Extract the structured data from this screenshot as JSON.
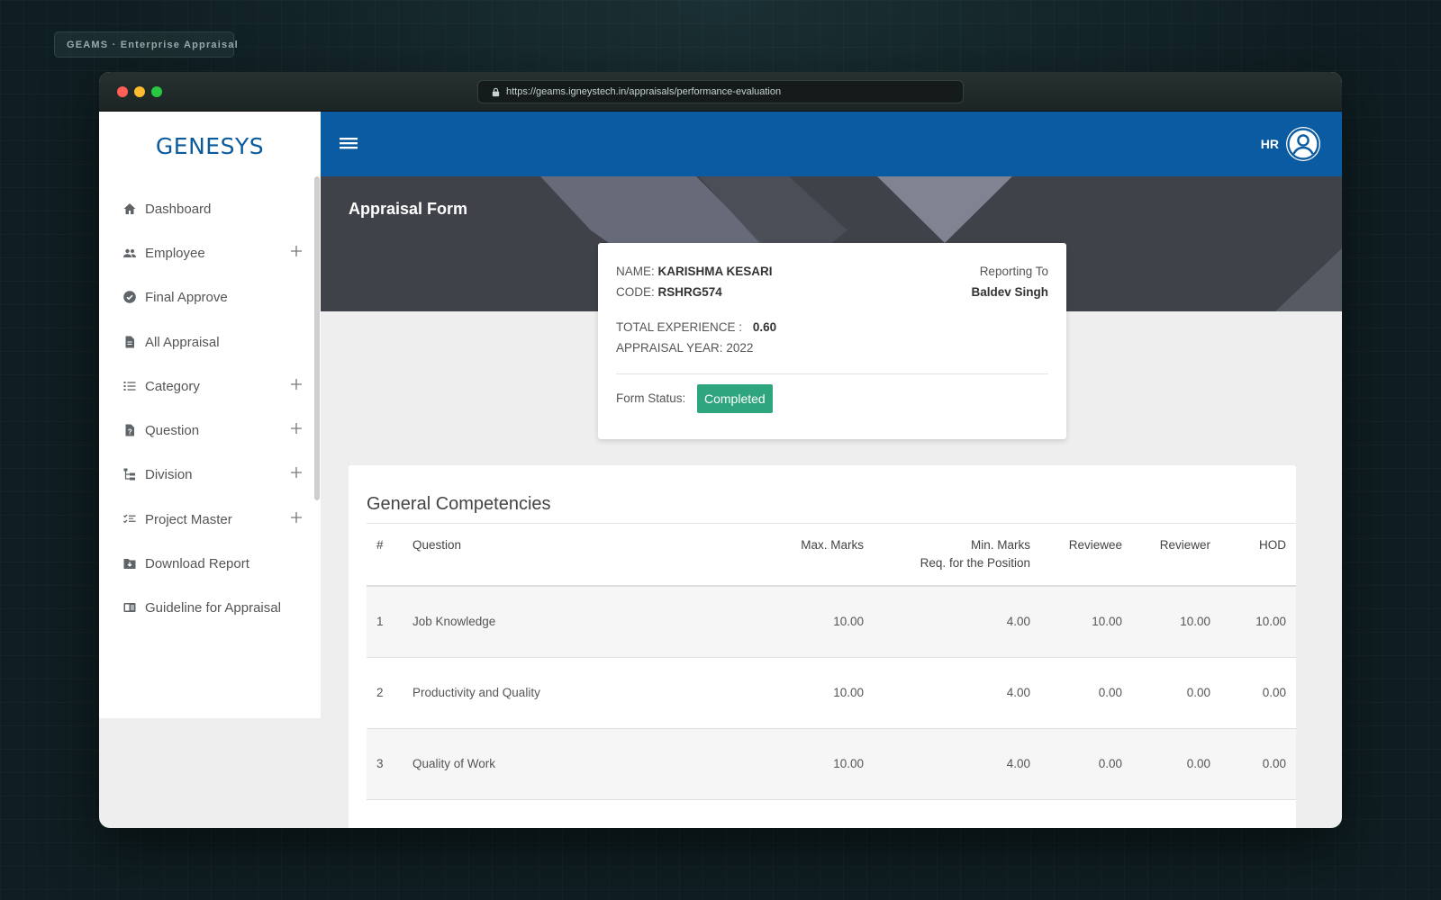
{
  "overlay": {
    "brand_label": "GEAMS · Enterprise Appraisal"
  },
  "browser": {
    "url": "https://geams.igneystech.in/appraisals/performance-evaluation"
  },
  "app": {
    "logo_text": "GENESYS"
  },
  "sidebar": {
    "items": [
      {
        "label": "Dashboard",
        "icon": "home-icon",
        "expandable": false
      },
      {
        "label": "Employee",
        "icon": "people-icon",
        "expandable": true
      },
      {
        "label": "Final Approve",
        "icon": "check-circle-icon",
        "expandable": false
      },
      {
        "label": "All Appraisal",
        "icon": "document-icon",
        "expandable": false
      },
      {
        "label": "Category",
        "icon": "list-icon",
        "expandable": true
      },
      {
        "label": "Question",
        "icon": "question-file-icon",
        "expandable": true
      },
      {
        "label": "Division",
        "icon": "hierarchy-icon",
        "expandable": true
      },
      {
        "label": "Project Master",
        "icon": "checklist-icon",
        "expandable": true
      },
      {
        "label": "Download Report",
        "icon": "download-folder-icon",
        "expandable": false
      },
      {
        "label": "Guideline for Appraisal",
        "icon": "book-icon",
        "expandable": false
      }
    ]
  },
  "topbar": {
    "user_label": "HR"
  },
  "page": {
    "title": "Appraisal Form"
  },
  "employee": {
    "name_label": "NAME:",
    "name": "KARISHMA KESARI",
    "code_label": "CODE:",
    "code": "RSHRG574",
    "reporting_label": "Reporting To",
    "reporting_to": "Baldev Singh",
    "experience_label": "TOTAL EXPERIENCE :",
    "experience": "0.60",
    "year_label": "APPRAISAL YEAR:",
    "year": "2022",
    "status_label": "Form Status:",
    "status": "Completed"
  },
  "competencies": {
    "title": "General Competencies",
    "headers": {
      "num": "#",
      "question": "Question",
      "max": "Max. Marks",
      "min_line1": "Min. Marks",
      "min_line2": "Req. for the Position",
      "reviewee": "Reviewee",
      "reviewer": "Reviewer",
      "hod": "HOD"
    },
    "rows": [
      {
        "num": "1",
        "question": "Job Knowledge",
        "max": "10.00",
        "min": "4.00",
        "reviewee": "10.00",
        "reviewer": "10.00",
        "hod": "10.00"
      },
      {
        "num": "2",
        "question": "Productivity and Quality",
        "max": "10.00",
        "min": "4.00",
        "reviewee": "0.00",
        "reviewer": "0.00",
        "hod": "0.00"
      },
      {
        "num": "3",
        "question": "Quality of Work",
        "max": "10.00",
        "min": "4.00",
        "reviewee": "0.00",
        "reviewer": "0.00",
        "hod": "0.00"
      }
    ]
  },
  "colors": {
    "topbar": "#0a5ba1",
    "banner": "#3f4249",
    "status_badge": "#2fa57f",
    "logo": "#0b5b9c"
  }
}
